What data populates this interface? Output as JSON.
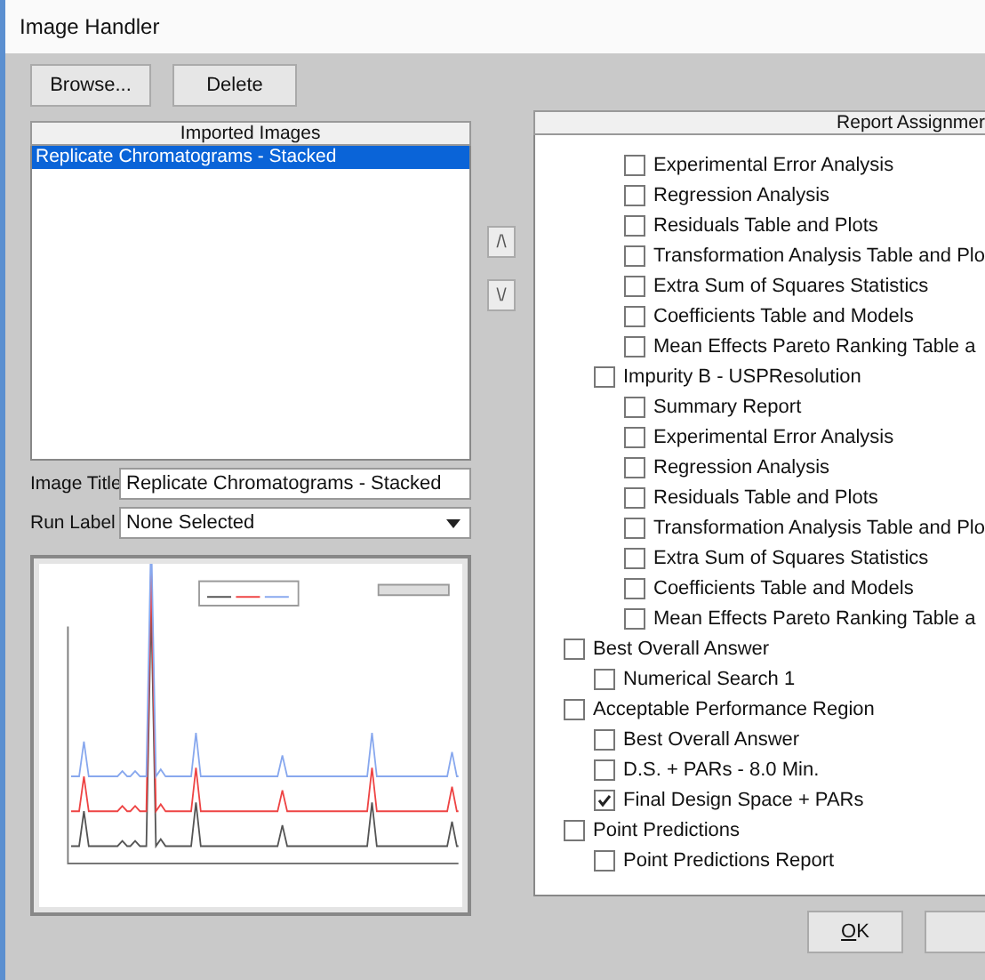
{
  "window": {
    "title": "Image Handler"
  },
  "toolbar": [
    {
      "label": "Browse..."
    },
    {
      "label": "Delete"
    }
  ],
  "imported_images": {
    "header": "Imported Images",
    "items": [
      {
        "label": "Replicate Chromatograms - Stacked",
        "selected": true
      }
    ]
  },
  "image_title": {
    "label": "Image Title",
    "value": "Replicate Chromatograms - Stacked"
  },
  "run_label": {
    "label": "Run Label",
    "value": "None Selected"
  },
  "preview": {
    "kind": "chromatogram"
  },
  "move_buttons": [
    {
      "label": "/\\"
    },
    {
      "label": "\\/"
    }
  ],
  "report_assignments": {
    "header": "Report Assignmer",
    "items": [
      {
        "children": [
          {
            "children": [
              {
                "label": "Experimental Error Analysis",
                "checked": false
              },
              {
                "label": "Regression Analysis",
                "checked": false
              },
              {
                "label": "Residuals Table and Plots",
                "checked": false
              },
              {
                "label": "Transformation Analysis Table and Plo",
                "checked": false
              },
              {
                "label": "Extra Sum of Squares Statistics",
                "checked": false
              },
              {
                "label": "Coefficients Table and Models",
                "checked": false
              },
              {
                "label": "Mean Effects Pareto Ranking Table a",
                "checked": false
              }
            ]
          },
          {
            "label": "Impurity B - USPResolution",
            "checked": false,
            "children": [
              {
                "label": "Summary Report",
                "checked": false
              },
              {
                "label": "Experimental Error Analysis",
                "checked": false
              },
              {
                "label": "Regression Analysis",
                "checked": false
              },
              {
                "label": "Residuals Table and Plots",
                "checked": false
              },
              {
                "label": "Transformation Analysis Table and Plo",
                "checked": false
              },
              {
                "label": "Extra Sum of Squares Statistics",
                "checked": false
              },
              {
                "label": "Coefficients Table and Models",
                "checked": false
              },
              {
                "label": "Mean Effects Pareto Ranking Table a",
                "checked": false
              }
            ]
          }
        ]
      },
      {
        "label": "Best Overall Answer",
        "checked": false,
        "children": [
          {
            "label": "Numerical Search 1",
            "checked": false
          }
        ]
      },
      {
        "label": "Acceptable Performance Region",
        "checked": false,
        "children": [
          {
            "label": "Best Overall Answer",
            "checked": false
          },
          {
            "label": "D.S. + PARs - 8.0 Min.",
            "checked": false
          },
          {
            "label": "Final Design Space + PARs",
            "checked": true
          }
        ]
      },
      {
        "label": "Point Predictions",
        "checked": false,
        "children": [
          {
            "label": "Point Predictions Report",
            "checked": false
          }
        ]
      }
    ]
  },
  "dialog_buttons": [
    {
      "kind": "labeled",
      "label": "OK",
      "mnemonic_underlined": true
    },
    {
      "kind": "cut_off"
    }
  ]
}
